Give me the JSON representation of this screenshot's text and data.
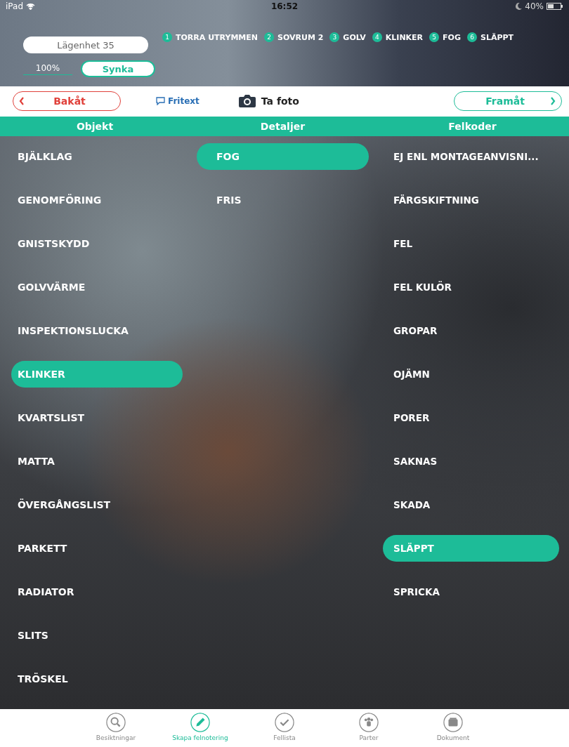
{
  "status_bar": {
    "device": "iPad",
    "time": "16:52",
    "battery": "40%"
  },
  "header": {
    "apartment": "Lägenhet 35",
    "progress": "100%",
    "sync_button": "Synka",
    "breadcrumbs": [
      {
        "number": "1",
        "label": "TORRA UTRYMMEN"
      },
      {
        "number": "2",
        "label": "SOVRUM 2"
      },
      {
        "number": "3",
        "label": "GOLV"
      },
      {
        "number": "4",
        "label": "KLINKER"
      },
      {
        "number": "5",
        "label": "FOG"
      },
      {
        "number": "6",
        "label": "SLÄPPT"
      }
    ]
  },
  "toolbar": {
    "back": "Bakåt",
    "free_text": "Fritext",
    "photo": "Ta foto",
    "forward": "Framåt"
  },
  "columns": [
    {
      "title": "Objekt",
      "items": [
        {
          "label": "BJÄLKLAG",
          "selected": false
        },
        {
          "label": "GENOMFÖRING",
          "selected": false
        },
        {
          "label": "GNISTSKYDD",
          "selected": false
        },
        {
          "label": "GOLVVÄRME",
          "selected": false
        },
        {
          "label": "INSPEKTIONSLUCKA",
          "selected": false
        },
        {
          "label": "KLINKER",
          "selected": true
        },
        {
          "label": "KVARTSLIST",
          "selected": false
        },
        {
          "label": "MATTA",
          "selected": false
        },
        {
          "label": "ÖVERGÅNGSLIST",
          "selected": false
        },
        {
          "label": "PARKETT",
          "selected": false
        },
        {
          "label": "RADIATOR",
          "selected": false
        },
        {
          "label": "SLITS",
          "selected": false
        },
        {
          "label": "TRÖSKEL",
          "selected": false
        }
      ]
    },
    {
      "title": "Detaljer",
      "items": [
        {
          "label": "FOG",
          "selected": true
        },
        {
          "label": "FRIS",
          "selected": false
        }
      ]
    },
    {
      "title": "Felkoder",
      "items": [
        {
          "label": "EJ ENL MONTAGEANVISNI...",
          "selected": false
        },
        {
          "label": "FÄRGSKIFTNING",
          "selected": false
        },
        {
          "label": "FEL",
          "selected": false
        },
        {
          "label": "FEL KULÖR",
          "selected": false
        },
        {
          "label": "GROPAR",
          "selected": false
        },
        {
          "label": "OJÄMN",
          "selected": false
        },
        {
          "label": "PORER",
          "selected": false
        },
        {
          "label": "SAKNAS",
          "selected": false
        },
        {
          "label": "SKADA",
          "selected": false
        },
        {
          "label": "SLÄPPT",
          "selected": true
        },
        {
          "label": "SPRICKA",
          "selected": false
        }
      ]
    }
  ],
  "tab_bar": [
    {
      "kind": "search",
      "label": "Besiktningar",
      "selected": false
    },
    {
      "kind": "pencil",
      "label": "Skapa felnotering",
      "selected": true
    },
    {
      "kind": "check",
      "label": "Fellista",
      "selected": false
    },
    {
      "kind": "people",
      "label": "Parter",
      "selected": false
    },
    {
      "kind": "box",
      "label": "Dokument",
      "selected": false
    }
  ]
}
